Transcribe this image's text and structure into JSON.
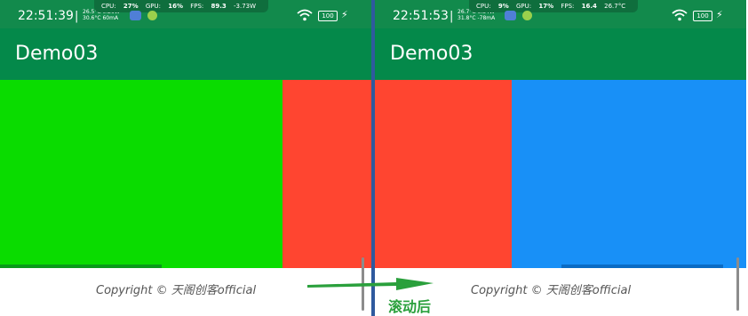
{
  "left": {
    "status": {
      "time": "22:51:39",
      "temp1": "26.5°C",
      "temp2": "30.6°C",
      "power1": "0.26W",
      "power2": "60mA",
      "cpu_label": "CPU:",
      "cpu": "27%",
      "gpu_label": "GPU:",
      "gpu": "16%",
      "fps_label": "FPS:",
      "fps": "89.3",
      "extra": "-3.73W",
      "battery": "100"
    },
    "app_title": "Demo03",
    "pages": [
      {
        "color": "#0adc00"
      },
      {
        "color": "#ff4530"
      }
    ],
    "footer_text": "Copyright © 天阁创客official"
  },
  "right": {
    "status": {
      "time": "22:51:53",
      "temp1": "26.7°C",
      "temp2": "31.8°C",
      "power1": "0.34W",
      "power2": "-78mA",
      "cpu_label": "CPU:",
      "cpu": "9%",
      "gpu_label": "GPU:",
      "gpu": "17%",
      "fps_label": "FPS:",
      "fps": "16.4",
      "extra": "26.7°C",
      "battery": "100"
    },
    "app_title": "Demo03",
    "pages": [
      {
        "color": "#ff4530"
      },
      {
        "color": "#1890f7"
      }
    ],
    "footer_text": "Copyright © 天阁创客official"
  },
  "caption": "滚动后",
  "colors": {
    "status_bar": "#128a4c",
    "app_bar": "#04894a",
    "arrow": "#2aa03c"
  }
}
